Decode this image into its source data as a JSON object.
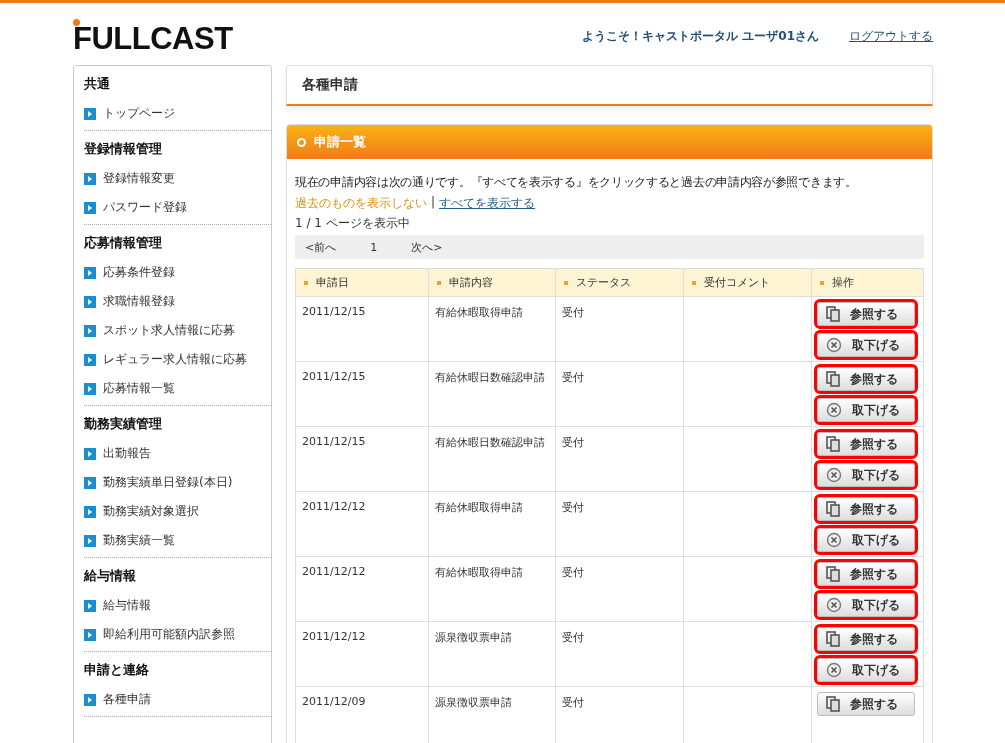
{
  "header": {
    "logo": "FULLCAST",
    "welcome": "ようこそ！キャストポータル ユーザ01さん",
    "logout": "ログアウトする"
  },
  "sidebar": {
    "sections": [
      {
        "title": "共通",
        "items": [
          "トップページ"
        ]
      },
      {
        "title": "登録情報管理",
        "items": [
          "登録情報変更",
          "パスワード登録"
        ]
      },
      {
        "title": "応募情報管理",
        "items": [
          "応募条件登録",
          "求職情報登録",
          "スポット求人情報に応募",
          "レギュラー求人情報に応募",
          "応募情報一覧"
        ]
      },
      {
        "title": "勤務実績管理",
        "items": [
          "出勤報告",
          "勤務実績単日登録(本日)",
          "勤務実績対象選択",
          "勤務実績一覧"
        ]
      },
      {
        "title": "給与情報",
        "items": [
          "給与情報",
          "即給利用可能額内訳参照"
        ]
      },
      {
        "title": "申請と連絡",
        "items": [
          "各種申請"
        ]
      }
    ]
  },
  "page_title": "各種申請",
  "panel": {
    "title": "申請一覧",
    "intro": "現在の申請内容は次の通りです。『すべてを表示する』をクリックすると過去の申請内容が参照できます。",
    "filter_hide": "過去のものを表示しない",
    "filter_separator": "|",
    "filter_all": "すべてを表示する",
    "page_info": "1 / 1 ページを表示中",
    "pager": {
      "prev": "<前へ",
      "page": "1",
      "next": "次へ>"
    },
    "table": {
      "columns": [
        "申請日",
        "申請内容",
        "ステータス",
        "受付コメント",
        "操作"
      ],
      "rows": [
        {
          "date": "2011/12/15",
          "content": "有給休暇取得申請",
          "status": "受付",
          "buttons": [
            {
              "kind": "view",
              "label": "参照する",
              "highlighted": true
            },
            {
              "kind": "withdraw",
              "label": "取下げる",
              "highlighted": true
            }
          ]
        },
        {
          "date": "2011/12/15",
          "content": "有給休暇日数確認申請",
          "status": "受付",
          "buttons": [
            {
              "kind": "view",
              "label": "参照する",
              "highlighted": true
            },
            {
              "kind": "withdraw",
              "label": "取下げる",
              "highlighted": true
            }
          ]
        },
        {
          "date": "2011/12/15",
          "content": "有給休暇日数確認申請",
          "status": "受付",
          "buttons": [
            {
              "kind": "view",
              "label": "参照する",
              "highlighted": true
            },
            {
              "kind": "withdraw",
              "label": "取下げる",
              "highlighted": true
            }
          ]
        },
        {
          "date": "2011/12/12",
          "content": "有給休暇取得申請",
          "status": "受付",
          "buttons": [
            {
              "kind": "view",
              "label": "参照する",
              "highlighted": true
            },
            {
              "kind": "withdraw",
              "label": "取下げる",
              "highlighted": true
            }
          ]
        },
        {
          "date": "2011/12/12",
          "content": "有給休暇取得申請",
          "status": "受付",
          "buttons": [
            {
              "kind": "view",
              "label": "参照する",
              "highlighted": true
            },
            {
              "kind": "withdraw",
              "label": "取下げる",
              "highlighted": true
            }
          ]
        },
        {
          "date": "2011/12/12",
          "content": "源泉徴収票申請",
          "status": "受付",
          "buttons": [
            {
              "kind": "view",
              "label": "参照する",
              "highlighted": true
            },
            {
              "kind": "withdraw",
              "label": "取下げる",
              "highlighted": true
            }
          ]
        },
        {
          "date": "2011/12/09",
          "content": "源泉徴収票申請",
          "status": "受付",
          "buttons": [
            {
              "kind": "view",
              "label": "参照する",
              "highlighted": false
            }
          ]
        }
      ]
    }
  }
}
